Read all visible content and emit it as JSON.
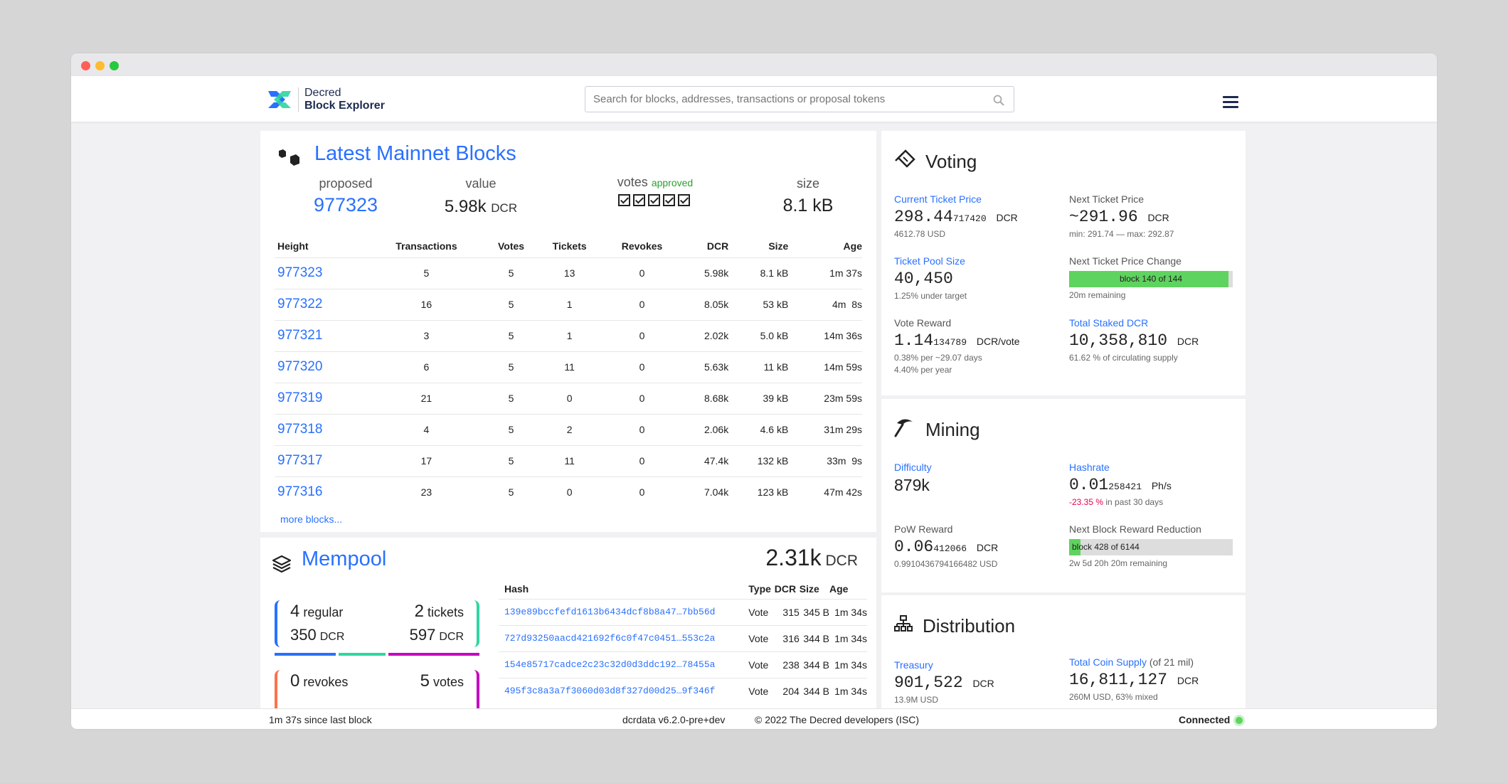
{
  "header": {
    "logo_line1": "Decred",
    "logo_line2": "Block Explorer",
    "search_placeholder": "Search for blocks, addresses, transactions or proposal tokens"
  },
  "blocks": {
    "title": "Latest Mainnet Blocks",
    "summary": {
      "proposed_label": "proposed",
      "proposed_value": "977323",
      "value_label": "value",
      "value_value": "5.98k",
      "value_unit": "DCR",
      "votes_label": "votes",
      "votes_status": "approved",
      "size_label": "size",
      "size_value": "8.1 kB"
    },
    "columns": [
      "Height",
      "Transactions",
      "Votes",
      "Tickets",
      "Revokes",
      "DCR",
      "Size",
      "Age"
    ],
    "rows": [
      [
        "977323",
        "5",
        "5",
        "13",
        "0",
        "5.98k",
        "8.1 kB",
        "1m 37s"
      ],
      [
        "977322",
        "16",
        "5",
        "1",
        "0",
        "8.05k",
        "53 kB",
        "4m  8s"
      ],
      [
        "977321",
        "3",
        "5",
        "1",
        "0",
        "2.02k",
        "5.0 kB",
        "14m 36s"
      ],
      [
        "977320",
        "6",
        "5",
        "11",
        "0",
        "5.63k",
        "11 kB",
        "14m 59s"
      ],
      [
        "977319",
        "21",
        "5",
        "0",
        "0",
        "8.68k",
        "39 kB",
        "23m 59s"
      ],
      [
        "977318",
        "4",
        "5",
        "2",
        "0",
        "2.06k",
        "4.6 kB",
        "31m 29s"
      ],
      [
        "977317",
        "17",
        "5",
        "11",
        "0",
        "47.4k",
        "132 kB",
        "33m  9s"
      ],
      [
        "977316",
        "23",
        "5",
        "0",
        "0",
        "7.04k",
        "123 kB",
        "47m 42s"
      ]
    ],
    "more_link": "more blocks..."
  },
  "mempool": {
    "title": "Mempool",
    "total_value": "2.31k",
    "total_unit": "DCR",
    "regular_count": "4",
    "regular_label": "regular",
    "regular_dcr": "350",
    "dcr_unit": "DCR",
    "tickets_count": "2",
    "tickets_label": "tickets",
    "tickets_dcr": "597",
    "revokes_count": "0",
    "revokes_label": "revokes",
    "votes_count": "5",
    "votes_label": "votes",
    "columns": [
      "Hash",
      "Type",
      "DCR",
      "Size",
      "Age"
    ],
    "rows": [
      [
        "139e89bccfefd1613b6434dcf8b8a47…7bb56d",
        "Vote",
        "315",
        "345 B",
        "1m 34s"
      ],
      [
        "727d93250aacd421692f6c0f47c0451…553c2a",
        "Vote",
        "316",
        "344 B",
        "1m 34s"
      ],
      [
        "154e85717cadce2c23c32d0d3ddc192…78455a",
        "Vote",
        "238",
        "344 B",
        "1m 34s"
      ],
      [
        "495f3c8a3a7f3060d03d8f327d00d25…9f346f",
        "Vote",
        "204",
        "344 B",
        "1m 34s"
      ]
    ],
    "colors": {
      "regular": "#2970ff",
      "tickets": "#2ed6a1",
      "revokes": "#fd714a",
      "votes": "#c600c0"
    }
  },
  "voting": {
    "title": "Voting",
    "current_ticket_price_label": "Current Ticket Price",
    "current_ticket_price_main": "298.44",
    "current_ticket_price_small": "717420",
    "current_ticket_price_usd": "4612.78 USD",
    "next_ticket_price_label": "Next Ticket Price",
    "next_ticket_price": "~291.96",
    "next_ticket_price_range": "min: 291.74 — max: 292.87",
    "pool_size_label": "Ticket Pool Size",
    "pool_size": "40,450",
    "pool_size_sub": "1.25% under target",
    "next_change_label": "Next Ticket Price Change",
    "next_change_bar": "block 140 of 144",
    "next_change_fraction": 0.972,
    "next_change_sub": "20m remaining",
    "vote_reward_label": "Vote Reward",
    "vote_reward_main": "1.14",
    "vote_reward_small": "134789",
    "vote_reward_unit": "DCR/vote",
    "vote_reward_sub1": "0.38% per ~29.07 days",
    "vote_reward_sub2": "4.40% per year",
    "staked_label": "Total Staked DCR",
    "staked_value": "10,358,810",
    "staked_sub": "61.62 % of circulating supply",
    "unit": "DCR"
  },
  "mining": {
    "title": "Mining",
    "difficulty_label": "Difficulty",
    "difficulty": "879k",
    "hashrate_label": "Hashrate",
    "hashrate_main": "0.01",
    "hashrate_small": "258421",
    "hashrate_unit": "Ph/s",
    "hashrate_change": "-23.35 %",
    "hashrate_change_sub": "in past 30 days",
    "pow_label": "PoW Reward",
    "pow_main": "0.06",
    "pow_small": "412066",
    "pow_unit": "DCR",
    "pow_usd": "0.9910436794166482 USD",
    "reduction_label": "Next Block Reward Reduction",
    "reduction_bar": "block 428 of 6144",
    "reduction_fraction": 0.07,
    "reduction_sub": "2w 5d 20h 20m remaining"
  },
  "distribution": {
    "title": "Distribution",
    "treasury_label": "Treasury",
    "treasury_value": "901,522",
    "treasury_usd": "13.9M USD",
    "supply_label": "Total Coin Supply",
    "supply_note": "(of 21 mil)",
    "supply_value": "16,811,127",
    "supply_sub": "260M USD, 63% mixed",
    "unit": "DCR"
  },
  "status": {
    "since_last_block": "1m 37s since last block",
    "version": "dcrdata v6.2.0-pre+dev",
    "copyright": "© 2022 The Decred developers (ISC)",
    "connection": "Connected"
  }
}
